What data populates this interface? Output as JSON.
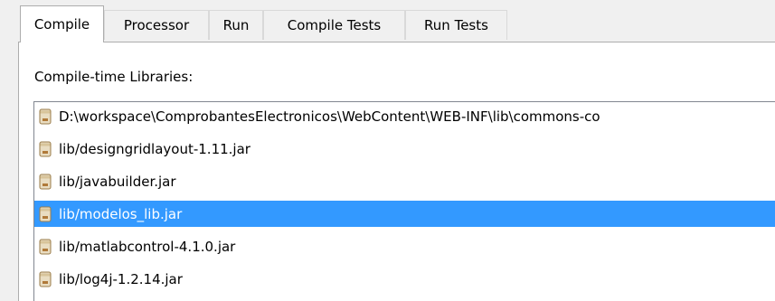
{
  "tabs": [
    {
      "label": "Compile",
      "active": true
    },
    {
      "label": "Processor",
      "active": false
    },
    {
      "label": "Run",
      "active": false
    },
    {
      "label": "Compile Tests",
      "active": false
    },
    {
      "label": "Run Tests",
      "active": false
    }
  ],
  "section_label": "Compile-time Libraries:",
  "libraries": [
    {
      "path": "D:\\workspace\\ComprobantesElectronicos\\WebContent\\WEB-INF\\lib\\commons-co",
      "icon": "jar-icon",
      "selected": false
    },
    {
      "path": "lib/designgridlayout-1.11.jar",
      "icon": "jar-icon",
      "selected": false
    },
    {
      "path": "lib/javabuilder.jar",
      "icon": "jar-icon",
      "selected": false
    },
    {
      "path": "lib/modelos_lib.jar",
      "icon": "jar-icon",
      "selected": true
    },
    {
      "path": "lib/matlabcontrol-4.1.0.jar",
      "icon": "jar-icon",
      "selected": false
    },
    {
      "path": "lib/log4j-1.2.14.jar",
      "icon": "jar-icon",
      "selected": false
    }
  ],
  "colors": {
    "selection": "#3399ff",
    "selection_text": "#ffffff"
  }
}
